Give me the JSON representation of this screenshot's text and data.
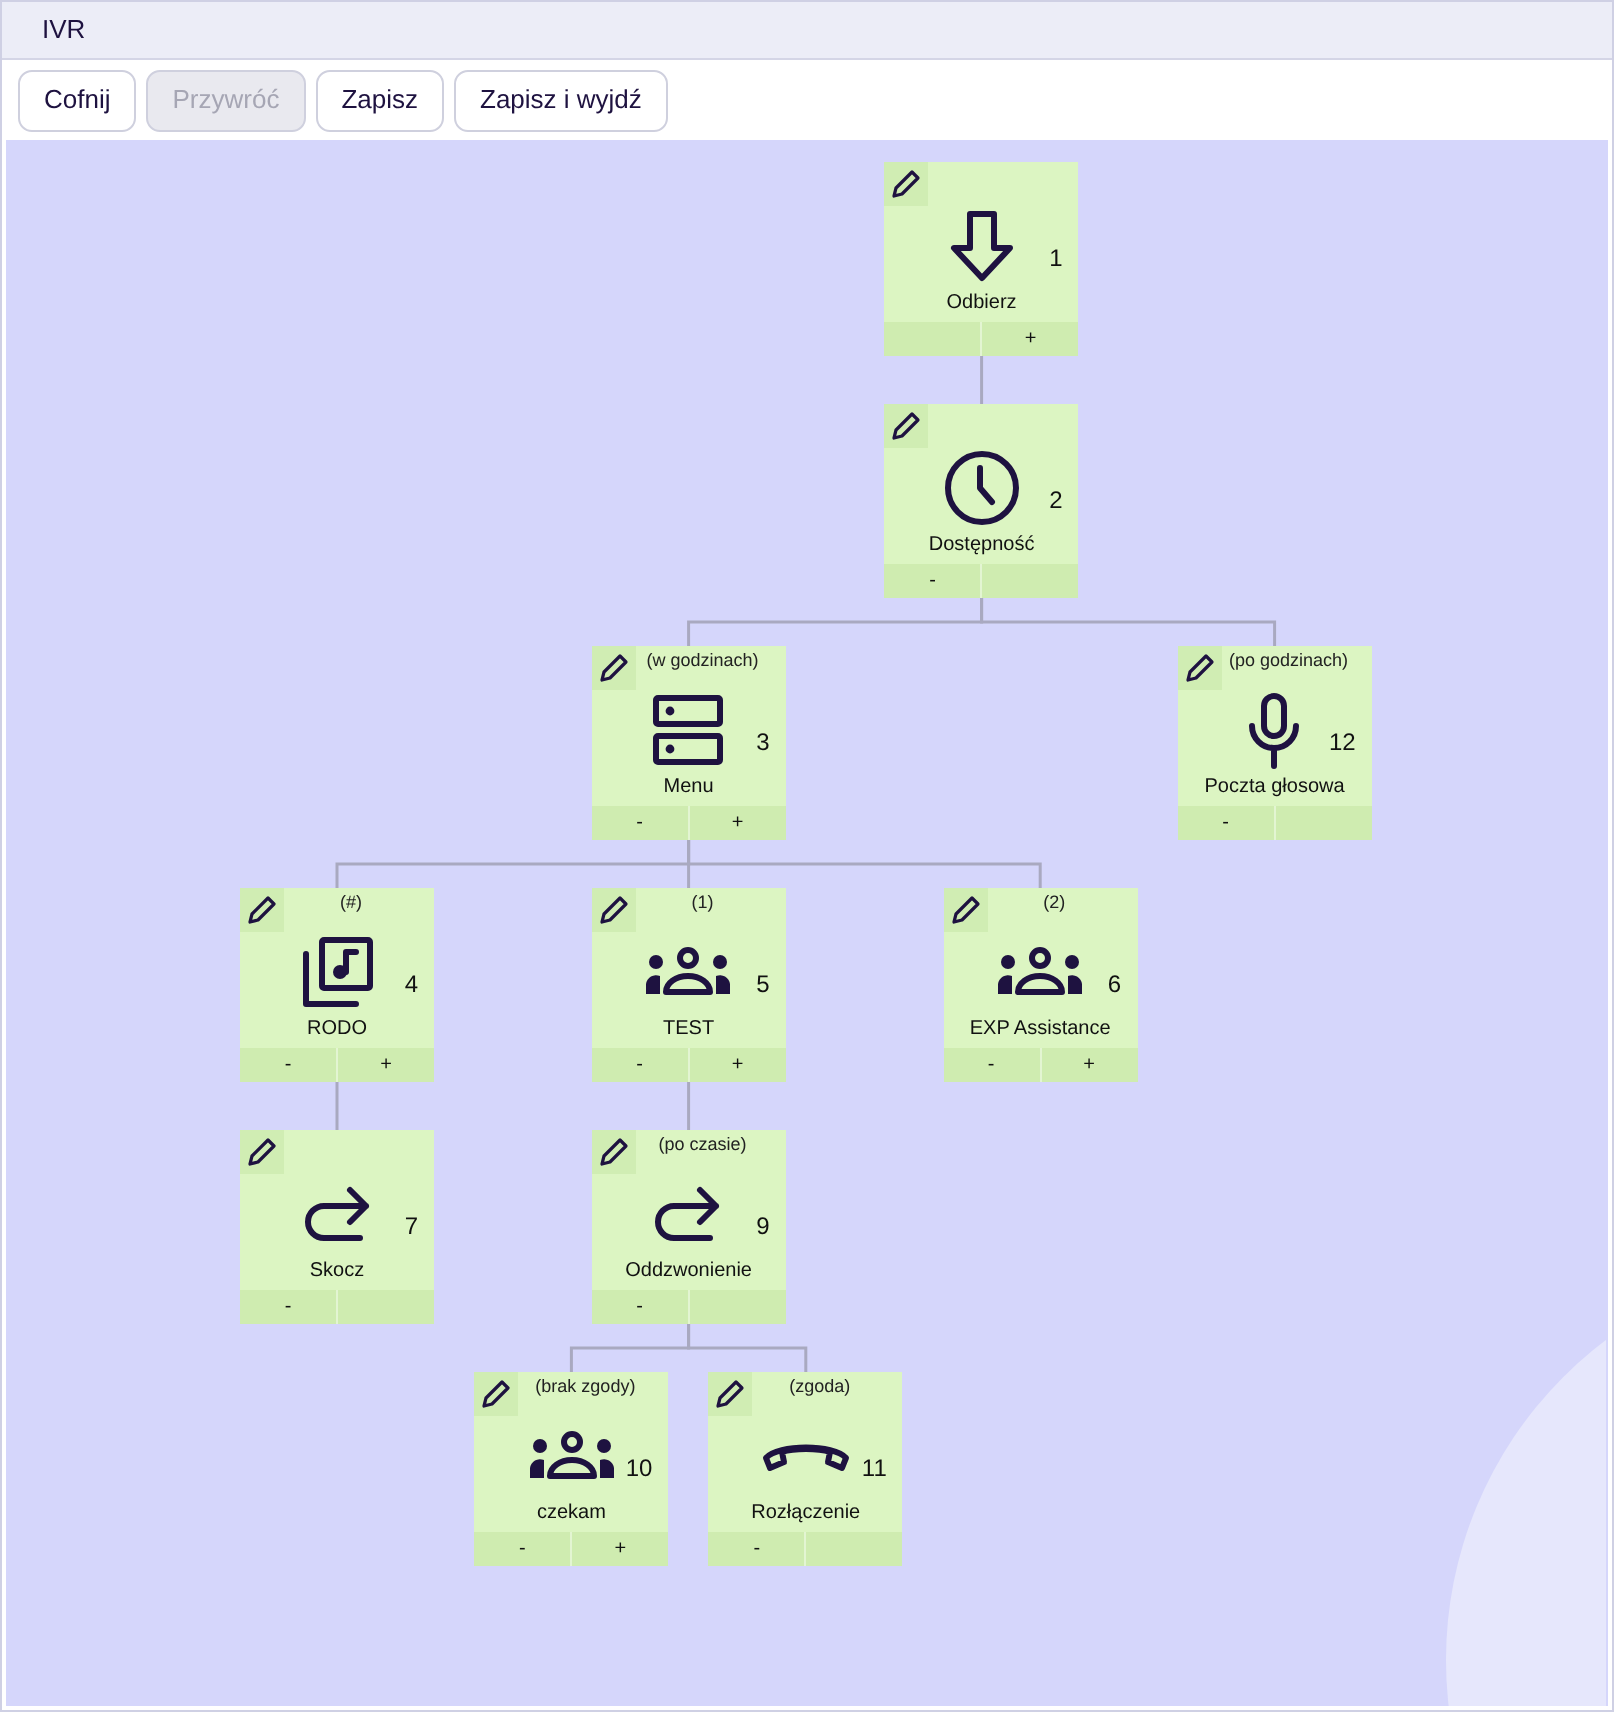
{
  "window": {
    "title": "IVR"
  },
  "toolbar": [
    {
      "label": "Cofnij",
      "disabled": false
    },
    {
      "label": "Przywróć",
      "disabled": true
    },
    {
      "label": "Zapisz",
      "disabled": false
    },
    {
      "label": "Zapisz i wyjdź",
      "disabled": false
    }
  ],
  "tree": {
    "number": "1",
    "name": "Odbierz",
    "kind": "answer",
    "expand": "+",
    "children": [
      {
        "number": "2",
        "name": "Dostępność",
        "kind": "clock",
        "collapse": "-",
        "children": [
          {
            "number": "3",
            "condition": "(w godzinach)",
            "name": "Menu",
            "kind": "menu",
            "collapse": "-",
            "expand": "+",
            "children": [
              {
                "number": "4",
                "condition": "(#)",
                "name": "RODO",
                "kind": "music",
                "collapse": "-",
                "expand": "+",
                "children": [
                  {
                    "number": "7",
                    "name": "Skocz",
                    "kind": "redirect",
                    "collapse": "-"
                  }
                ]
              },
              {
                "number": "5",
                "condition": "(1)",
                "name": "TEST",
                "kind": "group",
                "collapse": "-",
                "expand": "+",
                "children": [
                  {
                    "number": "9",
                    "condition": "(po czasie)",
                    "name": "Oddzwonienie",
                    "kind": "redirect",
                    "collapse": "-",
                    "children": [
                      {
                        "number": "10",
                        "condition": "(brak zgody)",
                        "name": "czekam",
                        "kind": "group",
                        "collapse": "-",
                        "expand": "+"
                      },
                      {
                        "number": "11",
                        "condition": "(zgoda)",
                        "name": "Rozłączenie",
                        "kind": "hangup",
                        "collapse": "-"
                      }
                    ]
                  }
                ]
              },
              {
                "number": "6",
                "condition": "(2)",
                "name": "EXP Assistance",
                "kind": "group",
                "collapse": "-",
                "expand": "+"
              }
            ]
          },
          {
            "number": "12",
            "condition": "(po godzinach)",
            "name": "Poczta głosowa",
            "kind": "mic",
            "collapse": "-"
          }
        ]
      }
    ]
  }
}
